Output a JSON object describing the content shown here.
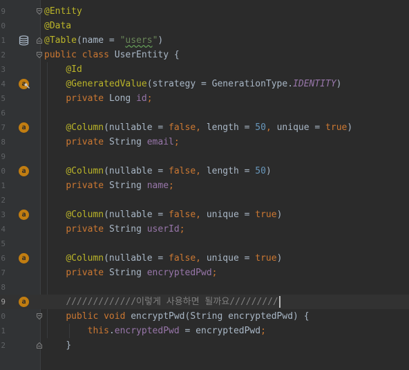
{
  "editor": {
    "line_numbers": [
      "8",
      "9",
      "0",
      "1",
      "2",
      "3",
      "4",
      "5",
      "6",
      "7",
      "8",
      "9",
      "0",
      "1",
      "2",
      "3",
      "4",
      "5",
      "6",
      "7",
      "8",
      "9",
      "0",
      "1",
      "2"
    ],
    "gutter_icons": {
      "3": "database-icon",
      "6": "annotation-key-icon",
      "9": "annotation-icon",
      "12": "annotation-icon",
      "15": "annotation-icon",
      "18": "annotation-icon",
      "21": "annotation-icon"
    },
    "annotation_letter": "a",
    "lines": [
      [],
      [
        {
          "t": "@Entity",
          "c": "annotation"
        }
      ],
      [
        {
          "t": "@Data",
          "c": "annotation"
        }
      ],
      [
        {
          "t": "@Table",
          "c": "annotation"
        },
        {
          "t": "(name = ",
          "c": "plain"
        },
        {
          "t": "\"",
          "c": "str"
        },
        {
          "t": "users",
          "c": "str typo"
        },
        {
          "t": "\"",
          "c": "str"
        },
        {
          "t": ")",
          "c": "plain"
        }
      ],
      [
        {
          "t": "public class ",
          "c": "kw"
        },
        {
          "t": "UserEntity {",
          "c": "plain"
        }
      ],
      [
        {
          "t": "    "
        },
        {
          "t": "@Id",
          "c": "annotation"
        }
      ],
      [
        {
          "t": "    "
        },
        {
          "t": "@GeneratedValue",
          "c": "annotation"
        },
        {
          "t": "(strategy = GenerationType.",
          "c": "plain"
        },
        {
          "t": "IDENTITY",
          "c": "konst"
        },
        {
          "t": ")",
          "c": "plain"
        }
      ],
      [
        {
          "t": "    "
        },
        {
          "t": "private ",
          "c": "kw"
        },
        {
          "t": "Long ",
          "c": "plain"
        },
        {
          "t": "id",
          "c": "field"
        },
        {
          "t": ";",
          "c": "kw"
        }
      ],
      [],
      [
        {
          "t": "    "
        },
        {
          "t": "@Column",
          "c": "annotation"
        },
        {
          "t": "(nullable = ",
          "c": "plain"
        },
        {
          "t": "false",
          "c": "kw"
        },
        {
          "t": ", ",
          "c": "kw"
        },
        {
          "t": "length = ",
          "c": "plain"
        },
        {
          "t": "50",
          "c": "num"
        },
        {
          "t": ", ",
          "c": "kw"
        },
        {
          "t": "unique = ",
          "c": "plain"
        },
        {
          "t": "true",
          "c": "kw"
        },
        {
          "t": ")",
          "c": "plain"
        }
      ],
      [
        {
          "t": "    "
        },
        {
          "t": "private ",
          "c": "kw"
        },
        {
          "t": "String ",
          "c": "plain"
        },
        {
          "t": "email",
          "c": "field"
        },
        {
          "t": ";",
          "c": "kw"
        }
      ],
      [],
      [
        {
          "t": "    "
        },
        {
          "t": "@Column",
          "c": "annotation"
        },
        {
          "t": "(nullable = ",
          "c": "plain"
        },
        {
          "t": "false",
          "c": "kw"
        },
        {
          "t": ", ",
          "c": "kw"
        },
        {
          "t": "length = ",
          "c": "plain"
        },
        {
          "t": "50",
          "c": "num"
        },
        {
          "t": ")",
          "c": "plain"
        }
      ],
      [
        {
          "t": "    "
        },
        {
          "t": "private ",
          "c": "kw"
        },
        {
          "t": "String ",
          "c": "plain"
        },
        {
          "t": "name",
          "c": "field"
        },
        {
          "t": ";",
          "c": "kw"
        }
      ],
      [],
      [
        {
          "t": "    "
        },
        {
          "t": "@Column",
          "c": "annotation"
        },
        {
          "t": "(nullable = ",
          "c": "plain"
        },
        {
          "t": "false",
          "c": "kw"
        },
        {
          "t": ", ",
          "c": "kw"
        },
        {
          "t": "unique = ",
          "c": "plain"
        },
        {
          "t": "true",
          "c": "kw"
        },
        {
          "t": ")",
          "c": "plain"
        }
      ],
      [
        {
          "t": "    "
        },
        {
          "t": "private ",
          "c": "kw"
        },
        {
          "t": "String ",
          "c": "plain"
        },
        {
          "t": "userId",
          "c": "field"
        },
        {
          "t": ";",
          "c": "kw"
        }
      ],
      [],
      [
        {
          "t": "    "
        },
        {
          "t": "@Column",
          "c": "annotation"
        },
        {
          "t": "(nullable = ",
          "c": "plain"
        },
        {
          "t": "false",
          "c": "kw"
        },
        {
          "t": ", ",
          "c": "kw"
        },
        {
          "t": "unique = ",
          "c": "plain"
        },
        {
          "t": "true",
          "c": "kw"
        },
        {
          "t": ")",
          "c": "plain"
        }
      ],
      [
        {
          "t": "    "
        },
        {
          "t": "private ",
          "c": "kw"
        },
        {
          "t": "String ",
          "c": "plain"
        },
        {
          "t": "encryptedPwd",
          "c": "field"
        },
        {
          "t": ";",
          "c": "kw"
        }
      ],
      [],
      [
        {
          "t": "    "
        },
        {
          "t": "/////////////이렇게 사용하면 될까요/////////",
          "c": "cmt"
        }
      ],
      [
        {
          "t": "    "
        },
        {
          "t": "public void ",
          "c": "kw"
        },
        {
          "t": "encryptPwd(String encryptedPwd) {",
          "c": "plain"
        }
      ],
      [
        {
          "t": "        "
        },
        {
          "t": "this",
          "c": "kw"
        },
        {
          "t": ".",
          "c": "plain"
        },
        {
          "t": "encryptedPwd",
          "c": "field"
        },
        {
          "t": " = encryptedPwd",
          "c": "plain"
        },
        {
          "t": ";",
          "c": "kw"
        }
      ],
      [
        {
          "t": "    "
        },
        {
          "t": "}",
          "c": "plain"
        }
      ]
    ],
    "current_line": 21
  }
}
